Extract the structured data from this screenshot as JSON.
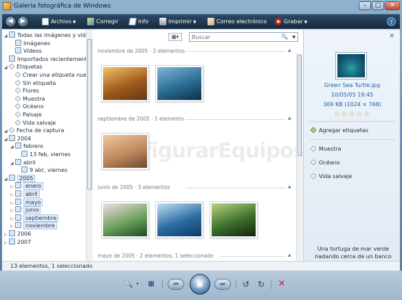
{
  "window": {
    "title": "Galería fotográfica de Windows",
    "min_label": "–",
    "max_label": "□",
    "close_label": "✕"
  },
  "toolbar": {
    "back_label": "◀",
    "forward_label": "▶",
    "items": [
      {
        "label": "Archivo",
        "icon": "file-icon",
        "has_menu": true
      },
      {
        "label": "Corregir",
        "icon": "fix-icon",
        "has_menu": false
      },
      {
        "label": "Info",
        "icon": "info-icon",
        "has_menu": false
      },
      {
        "label": "Imprimir",
        "icon": "print-icon",
        "has_menu": true
      },
      {
        "label": "Correo electrónico",
        "icon": "email-icon",
        "has_menu": false
      },
      {
        "label": "Grabar",
        "icon": "burn-disc-icon",
        "has_menu": true
      }
    ],
    "help_label": "?"
  },
  "nav_tree": [
    {
      "label": "Todas las imágenes y vídeos",
      "kind": "folder",
      "exp": "◢",
      "indent": 0
    },
    {
      "label": "Imágenes",
      "kind": "folder",
      "exp": "",
      "indent": 1
    },
    {
      "label": "Vídeos",
      "kind": "folder",
      "exp": "",
      "indent": 1
    },
    {
      "label": "Importados recientemente",
      "kind": "folder",
      "exp": "",
      "indent": 0
    },
    {
      "label": "Etiquetas",
      "kind": "tag",
      "exp": "◢",
      "indent": 0
    },
    {
      "label": "Crear una etiqueta nueva",
      "kind": "tag",
      "exp": "",
      "indent": 1,
      "italic": true
    },
    {
      "label": "Sin etiqueta",
      "kind": "tag",
      "exp": "",
      "indent": 1
    },
    {
      "label": "Flores",
      "kind": "tag",
      "exp": "",
      "indent": 1
    },
    {
      "label": "Muestra",
      "kind": "tag",
      "exp": "",
      "indent": 1
    },
    {
      "label": "Océano",
      "kind": "tag",
      "exp": "",
      "indent": 1
    },
    {
      "label": "Paisaje",
      "kind": "tag",
      "exp": "",
      "indent": 1
    },
    {
      "label": "Vida salvaje",
      "kind": "tag",
      "exp": "",
      "indent": 1
    },
    {
      "label": "Fecha de captura",
      "kind": "tag",
      "exp": "◢",
      "indent": 0
    },
    {
      "label": "2004",
      "kind": "folder",
      "exp": "◢",
      "indent": 0
    },
    {
      "label": "febrero",
      "kind": "folder",
      "exp": "◢",
      "indent": 1
    },
    {
      "label": "13 feb, viernes",
      "kind": "folder",
      "exp": "",
      "indent": 2
    },
    {
      "label": "abril",
      "kind": "folder",
      "exp": "◢",
      "indent": 1
    },
    {
      "label": "9 abr, viernes",
      "kind": "folder",
      "exp": "",
      "indent": 2
    },
    {
      "label": "2005",
      "kind": "folder",
      "exp": "◢",
      "indent": 0,
      "highlight": true
    },
    {
      "label": "enero",
      "kind": "folder",
      "exp": "▷",
      "indent": 1,
      "highlight": true
    },
    {
      "label": "abril",
      "kind": "folder",
      "exp": "▷",
      "indent": 1,
      "highlight": true
    },
    {
      "label": "mayo",
      "kind": "folder",
      "exp": "▷",
      "indent": 1,
      "highlight": true
    },
    {
      "label": "junio",
      "kind": "folder",
      "exp": "▷",
      "indent": 1,
      "highlight": true
    },
    {
      "label": "septiembre",
      "kind": "folder",
      "exp": "▷",
      "indent": 1,
      "highlight": true
    },
    {
      "label": "noviembre",
      "kind": "folder",
      "exp": "▷",
      "indent": 1,
      "highlight": true
    },
    {
      "label": "2006",
      "kind": "folder",
      "exp": "▷",
      "indent": 0
    },
    {
      "label": "2007",
      "kind": "folder",
      "exp": "▷",
      "indent": 0
    }
  ],
  "view_button": {
    "label": "▦▾"
  },
  "search": {
    "placeholder": "Buscar",
    "value": "",
    "icon": "🔍",
    "dropdown": "▼"
  },
  "groups": [
    {
      "header": "noviembre de 2005 · 2 elementos",
      "collapse": "▲",
      "thumbs": [
        {
          "name": "autumn-leaves-photo",
          "colors": [
            "#f0c46a",
            "#a35a1c",
            "#5f3a16"
          ]
        },
        {
          "name": "humpback-whale-photo",
          "colors": [
            "#7fb6d7",
            "#2b6d94",
            "#0d2e46"
          ]
        }
      ]
    },
    {
      "header": "septiembre de 2005 · 1 elemento",
      "collapse": "▲",
      "thumbs": [
        {
          "name": "oryx-antelope-photo",
          "colors": [
            "#f0c9a0",
            "#bf8a5e",
            "#6b4a2f"
          ]
        }
      ]
    },
    {
      "header": "junio de 2005 · 3 elementos",
      "collapse": "▲",
      "thumbs": [
        {
          "name": "frangipani-flowers-photo",
          "colors": [
            "#f3dce6",
            "#6ea35c",
            "#1f4a25"
          ]
        },
        {
          "name": "waterfall-photo",
          "colors": [
            "#bfe0f4",
            "#2b6da3",
            "#0d3a66"
          ]
        },
        {
          "name": "toco-toucan-photo",
          "colors": [
            "#b7d47e",
            "#3e6f2c",
            "#11240f"
          ]
        }
      ]
    },
    {
      "header": "mayo de 2005 · 2 elementos, 1 seleccionado",
      "collapse": "▲",
      "thumbs": []
    }
  ],
  "watermark": {
    "text": "figurarEquipos"
  },
  "info_pane": {
    "close_label": "✕",
    "file_name": "Green Sea Turtle.jpg",
    "date": "10/05/05   19:45",
    "size": "369 KB (1024 × 768)",
    "stars": "☆☆☆☆☆",
    "add_tags_label": "Agregar etiquetas",
    "tags": [
      "Muestra",
      "Océano",
      "Vida salvaje"
    ],
    "caption": "Una tortuga de mar verde nadando cerca de un banco de..."
  },
  "status": {
    "text": "13 elementos, 1 seleccionado"
  },
  "player": {
    "zoom": "🔍",
    "zoom_menu": "▾",
    "grid": "▦",
    "prev": "⏮",
    "slideshow": "▣",
    "next": "⏭",
    "rotate_left": "↺",
    "rotate_right": "↻",
    "delete": "✕"
  },
  "colors": {
    "toolbar_bg": "#16293c",
    "link_blue": "#1f5fa8",
    "selection": "#dcecfc",
    "delete_red": "#c0272d"
  }
}
